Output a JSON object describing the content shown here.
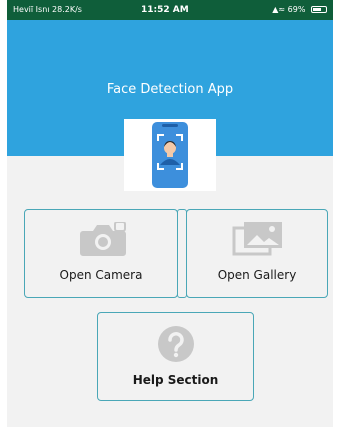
{
  "status_bar": {
    "left_text": "Heviĩ Isnı 28.2K/s",
    "time": "11:52 AM",
    "right_text": "69%"
  },
  "header": {
    "title": "Face Detection App"
  },
  "buttons": {
    "camera_label": "Open Camera",
    "gallery_label": "Open Gallery",
    "help_label": "Help Section"
  },
  "colors": {
    "status_bar": "#0f5e3a",
    "header": "#2fa3de",
    "button_border": "#4aa7b7",
    "icon_gray": "#c8c8c8"
  },
  "icons": {
    "logo": "face-scan-phone-icon",
    "camera": "camera-icon",
    "gallery": "gallery-icon",
    "help": "question-mark-icon"
  }
}
